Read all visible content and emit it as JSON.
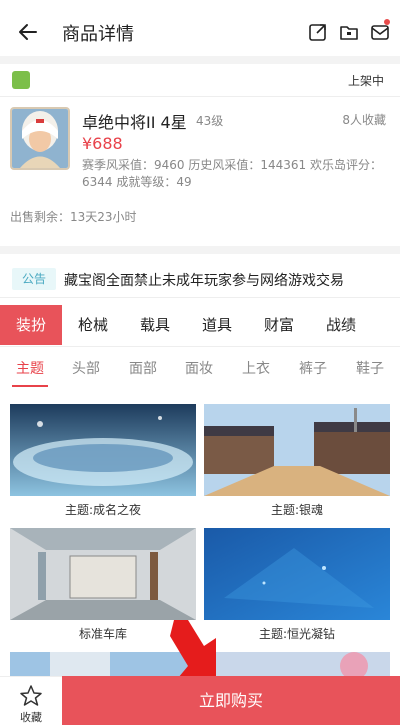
{
  "header": {
    "title": "商品详情"
  },
  "status": {
    "platform_icon": "android-icon",
    "label": "上架中"
  },
  "item": {
    "name": "卓绝中将II 4星",
    "level": "43级",
    "favorites": "8人收藏",
    "price": "¥688",
    "stats": "赛季风采值：9460  历史风采值：144361  欢乐岛评分：6344  成就等级：49",
    "remaining": "出售剩余：13天23小时"
  },
  "notice": {
    "tag": "公告",
    "text": "藏宝阁全面禁止未成年玩家参与网络游戏交易"
  },
  "main_tabs": [
    "装扮",
    "枪械",
    "载具",
    "道具",
    "财富",
    "战绩"
  ],
  "sub_tabs": [
    "主题",
    "头部",
    "面部",
    "面妆",
    "上衣",
    "裤子",
    "鞋子"
  ],
  "grid": [
    {
      "caption": "主题:成名之夜"
    },
    {
      "caption": "主题:银魂"
    },
    {
      "caption": "标准车库"
    },
    {
      "caption": "主题:恒光凝钻"
    }
  ],
  "bottom": {
    "favorite_label": "收藏",
    "buy_label": "立即购买"
  },
  "colors": {
    "accent": "#e8535a",
    "price": "#e8424a",
    "notice_tag_bg": "#e8f7f9",
    "notice_tag_text": "#4aa9c1"
  }
}
